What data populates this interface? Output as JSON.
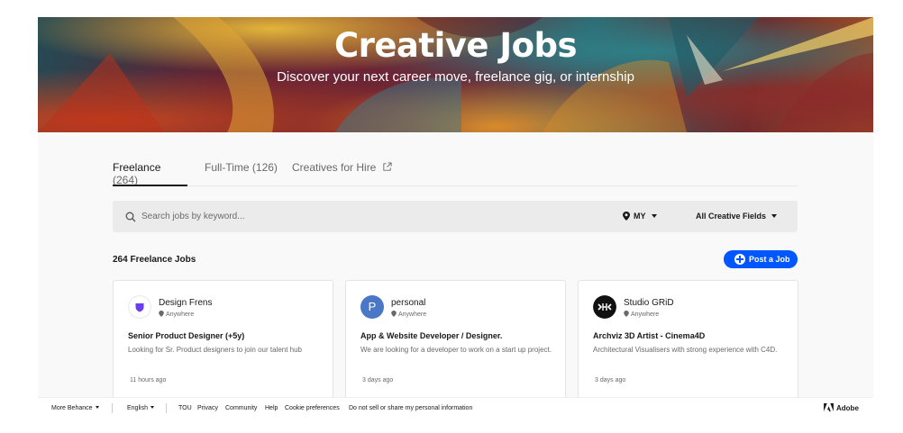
{
  "hero": {
    "title": "Creative Jobs",
    "subtitle": "Discover your next career move, freelance gig, or internship"
  },
  "tabs": [
    {
      "label": "Freelance",
      "count": "(264)",
      "active": true
    },
    {
      "label": "Full-Time",
      "count": "(126)",
      "active": false
    },
    {
      "label": "Creatives for Hire",
      "icon": "external-link-icon",
      "active": false
    }
  ],
  "search": {
    "placeholder": "Search jobs by keyword...",
    "location": "MY",
    "fields": "All Creative Fields"
  },
  "listing": {
    "count_label": "264 Freelance Jobs",
    "post_button": "Post a Job"
  },
  "cards": [
    {
      "company": "Design Frens",
      "location": "Anywhere",
      "title": "Senior Product Designer (+5y)",
      "description": "Looking for Sr. Product designers to join our talent hub",
      "time": "11 hours ago",
      "logo_icon": "shield-logo-icon"
    },
    {
      "company": "personal",
      "location": "Anywhere",
      "title": "App & Website Developer / Designer.",
      "description": "We are looking for a developer to work on a start up project.",
      "time": "3 days ago",
      "logo_letter": "P",
      "logo_color": "#4a78c6"
    },
    {
      "company": "Studio GRiD",
      "location": "Anywhere",
      "title": "Archviz 3D Artist - Cinema4D",
      "description": "Architectural Visualisers with strong experience with C4D.",
      "time": "3 days ago",
      "logo_icon": "studio-grid-logo-icon"
    }
  ],
  "footer": {
    "more": "More Behance",
    "language": "English",
    "links": [
      "TOU",
      "Privacy",
      "Community",
      "Help",
      "Cookie preferences",
      "Do not sell or share my personal information"
    ],
    "brand": "Adobe"
  },
  "colors": {
    "accent": "#0057ff",
    "text": "#191919",
    "muted": "#696969",
    "search_bg": "#ebebeb",
    "main_bg": "#f9f9f9"
  }
}
